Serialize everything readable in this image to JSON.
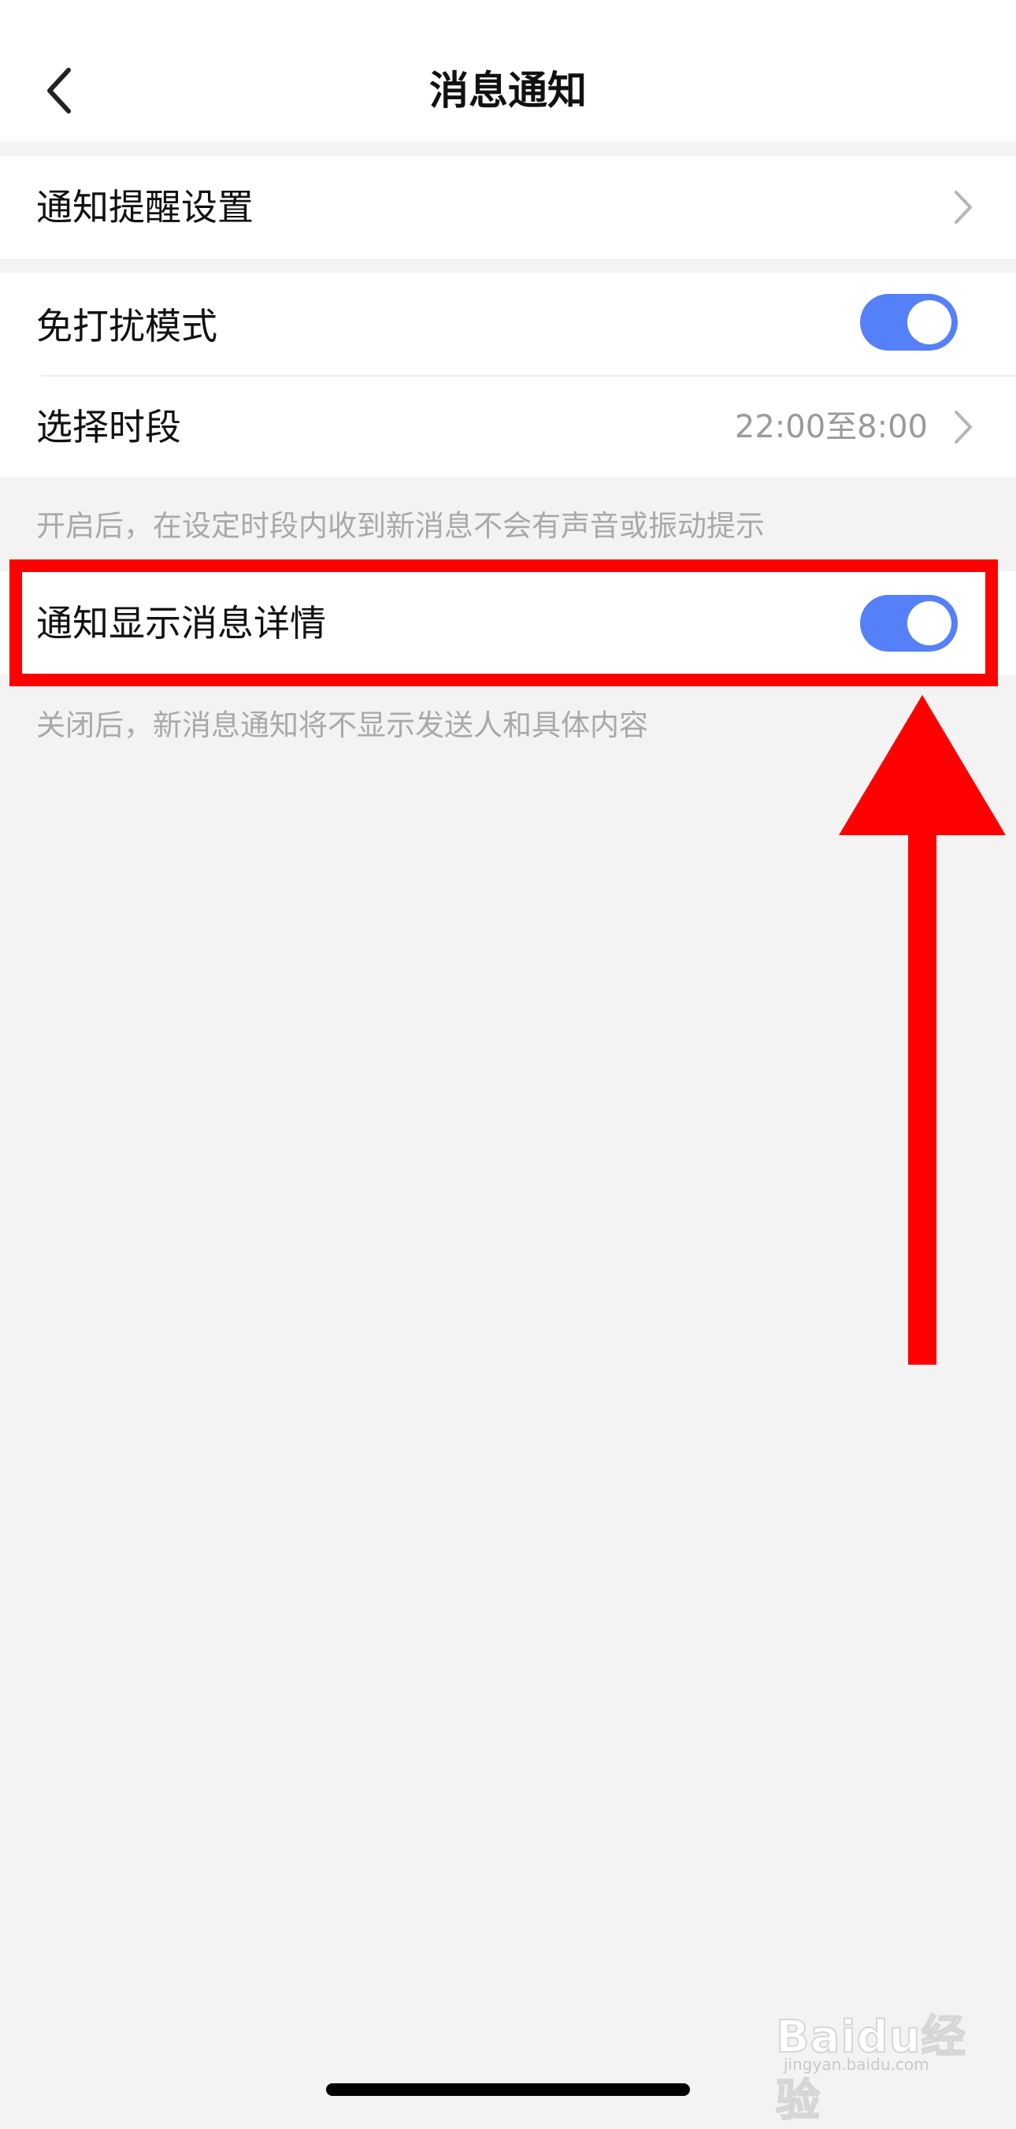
{
  "header": {
    "title": "消息通知",
    "back_icon": "chevron-left-icon"
  },
  "sections": {
    "notification_settings": {
      "label": "通知提醒设置"
    },
    "do_not_disturb": {
      "label": "免打扰模式",
      "enabled": true
    },
    "time_range": {
      "label": "选择时段",
      "value": "22:00至8:00"
    },
    "dnd_hint": "开启后，在设定时段内收到新消息不会有声音或振动提示",
    "show_details": {
      "label": "通知显示消息详情",
      "enabled": true
    },
    "details_hint": "关闭后，新消息通知将不显示发送人和具体内容"
  },
  "colors": {
    "toggle_on": "#5680f7",
    "highlight": "#ff0000",
    "background": "#f3f3f3"
  },
  "watermark": {
    "brand": "Baidu经验",
    "url": "jingyan.baidu.com"
  }
}
